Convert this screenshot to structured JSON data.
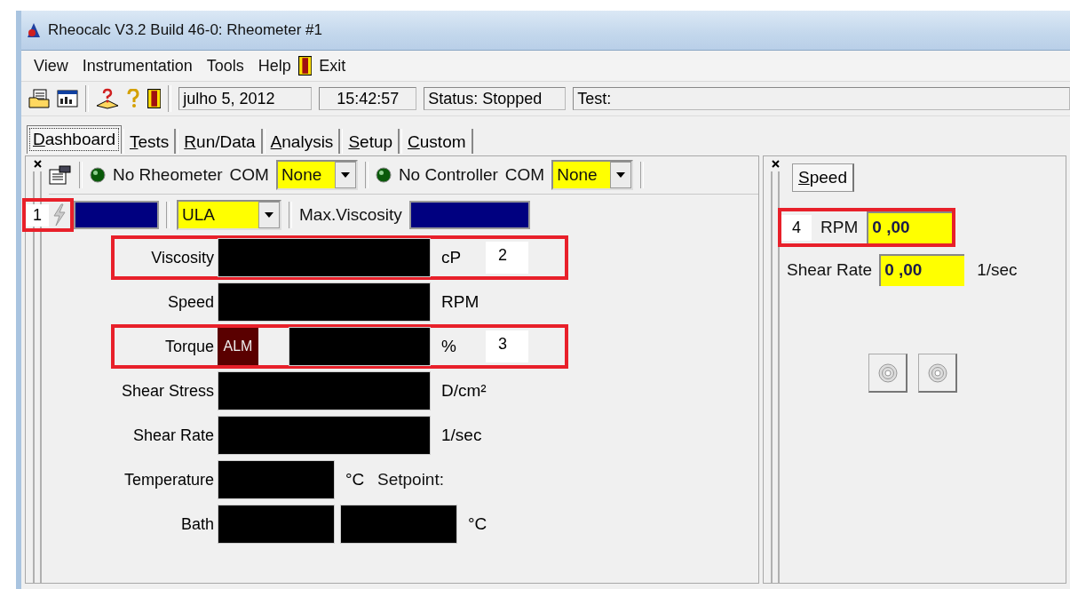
{
  "window": {
    "title": "Rheocalc V3.2 Build 46-0: Rheometer #1"
  },
  "menu": [
    {
      "label": "View",
      "kind": "text"
    },
    {
      "label": "Instrumentation",
      "kind": "text"
    },
    {
      "label": "Tools",
      "kind": "text"
    },
    {
      "label": "Help",
      "kind": "text"
    },
    {
      "label": "Exit",
      "kind": "exit"
    }
  ],
  "toolbar": {
    "fields": [
      "julho 5, 2012",
      "15:42:57",
      "Status: Stopped",
      "Test:"
    ]
  },
  "tabs": [
    {
      "label": "Dashboard",
      "selected": true
    },
    {
      "label": "Tests",
      "selected": false
    },
    {
      "label": "Run/Data",
      "selected": false
    },
    {
      "label": "Analysis",
      "selected": false
    },
    {
      "label": "Setup",
      "selected": false
    },
    {
      "label": "Custom",
      "selected": false
    }
  ],
  "dashboard": {
    "connections": [
      {
        "label": "No Rheometer",
        "com_label": "COM",
        "port": "None"
      },
      {
        "label": "No Controller",
        "com_label": "COM",
        "port": "None"
      }
    ],
    "channel": {
      "marker": "1",
      "mode": "ULA",
      "max_label": "Max.Viscosity"
    },
    "readings": [
      {
        "kind": "display",
        "label": "Viscosity",
        "unit": "cP",
        "marker": "2"
      },
      {
        "kind": "display",
        "label": "Speed",
        "unit": "RPM"
      },
      {
        "kind": "alarm",
        "label": "Torque",
        "alarm": "ALM",
        "unit": "%",
        "marker": "3"
      },
      {
        "kind": "display",
        "label": "Shear Stress",
        "unit": "D/cm²"
      },
      {
        "kind": "display",
        "label": "Shear Rate",
        "unit": "1/sec"
      },
      {
        "kind": "setpoint",
        "label": "Temperature",
        "unit": "°C",
        "extra": "Setpoint:"
      },
      {
        "kind": "double",
        "label": "Bath",
        "unit": "°C"
      }
    ]
  },
  "speed_panel": {
    "tab": {
      "label": "Speed",
      "selected": true
    },
    "marker": "4",
    "rpm_label": "RPM",
    "rpm_value": "0 ,00",
    "shear_label": "Shear Rate",
    "shear_value": "0 ,00",
    "shear_unit": "1/sec"
  }
}
